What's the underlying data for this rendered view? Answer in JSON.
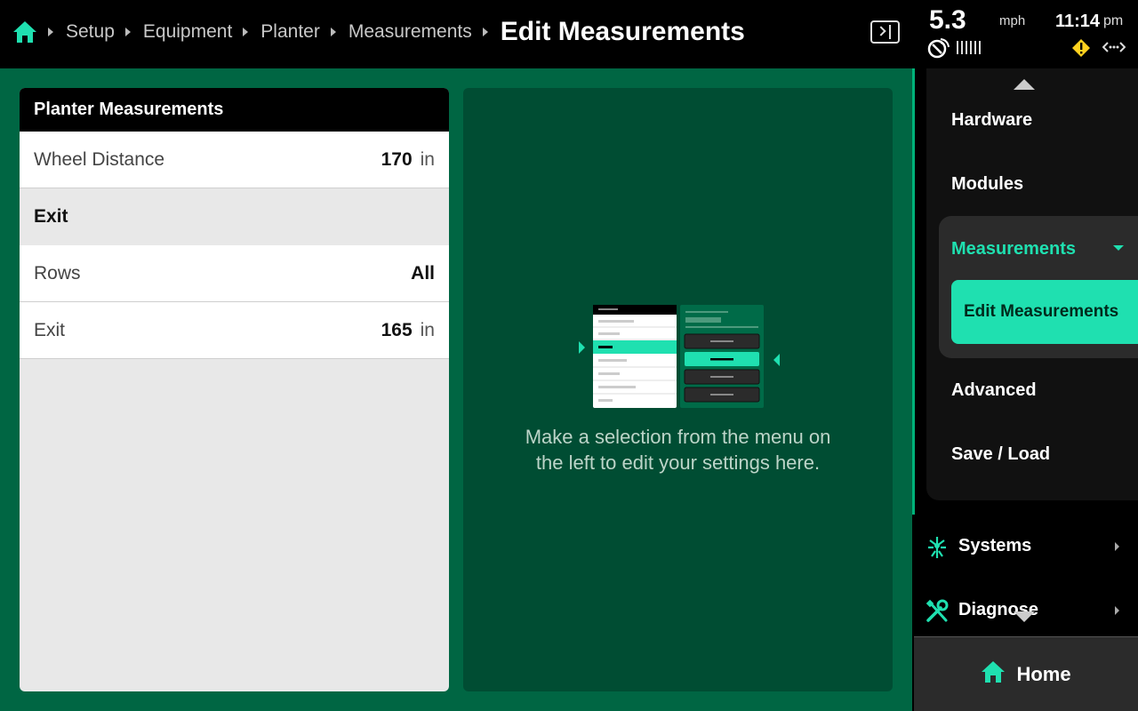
{
  "breadcrumb": {
    "home_icon": "home-icon",
    "items": [
      "Setup",
      "Equipment",
      "Planter",
      "Measurements"
    ],
    "current": "Edit Measurements"
  },
  "status": {
    "speed": "5.3",
    "speed_unit": "mph",
    "time": "11:14",
    "ampm": "pm",
    "icons": [
      "panel-toggle-icon",
      "gps-satellite-icon",
      "signal-bars-icon",
      "warning-icon",
      "connection-icon"
    ]
  },
  "card": {
    "title": "Planter Measurements",
    "rows": [
      {
        "label": "Wheel Distance",
        "value": "170",
        "unit": "in"
      }
    ],
    "section": "Exit",
    "section_rows": [
      {
        "label": "Rows",
        "value": "All",
        "unit": ""
      },
      {
        "label": "Exit",
        "value": "165",
        "unit": "in"
      }
    ]
  },
  "placeholder": {
    "line1": "Make a selection from the menu on",
    "line2": "the left to edit your settings here."
  },
  "sidebar": {
    "items": [
      "Hardware",
      "Modules"
    ],
    "group_label": "Measurements",
    "group_child": "Edit Measurements",
    "items_after": [
      "Advanced",
      "Save / Load"
    ],
    "systems": [
      {
        "label": "Systems",
        "icon": "planter-icon"
      },
      {
        "label": "Diagnose",
        "icon": "tools-icon"
      }
    ],
    "home_label": "Home"
  },
  "colors": {
    "accent": "#1fe0b0",
    "background": "#006643",
    "panel": "#004d33"
  }
}
